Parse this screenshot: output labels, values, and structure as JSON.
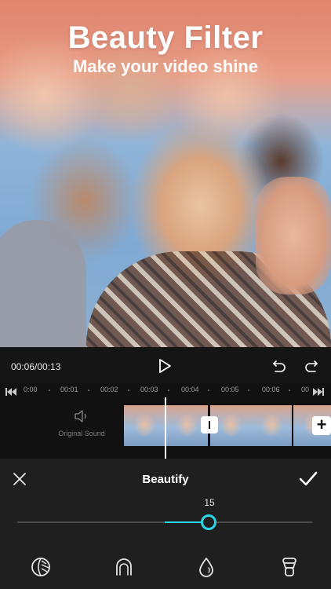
{
  "promo": {
    "title": "Beauty Filter",
    "subtitle": "Make your video shine"
  },
  "player": {
    "timecode": "00:06/00:13",
    "play_icon": "play-icon",
    "undo_icon": "undo-icon",
    "redo_icon": "redo-icon"
  },
  "ruler": {
    "ticks": [
      "0:00",
      "00:01",
      "00:02",
      "00:03",
      "00:04",
      "00:05",
      "00:06",
      "00"
    ]
  },
  "timeline": {
    "original_sound_label": "Original Sound",
    "add_clip_label": "+"
  },
  "beautify": {
    "title": "Beautify",
    "value": "15",
    "level_fraction": 0.65,
    "accent_color": "#2ad5e8",
    "tools": [
      "skin-smooth-icon",
      "face-shape-icon",
      "drop-icon",
      "foundation-icon"
    ]
  }
}
